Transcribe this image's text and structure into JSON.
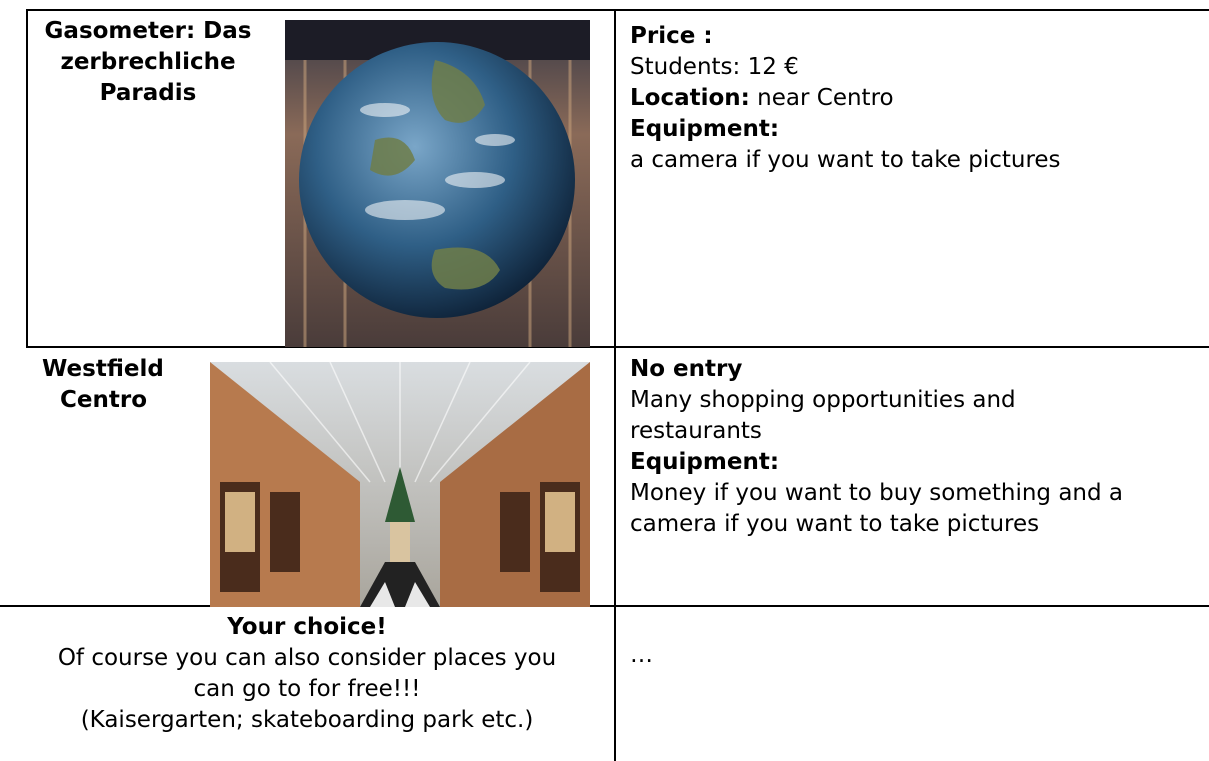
{
  "rows": [
    {
      "left_title_lines": [
        "Gasometer: Das",
        "zerbrechliche",
        "Paradis"
      ],
      "image_icon": "globe-photo",
      "right": {
        "price_label": "Price :",
        "price_value": "Students: 12 €",
        "location_label": "Location:",
        "location_value": " near Centro",
        "equipment_label": "Equipment:",
        "equipment_value": "a camera if you want to take pictures"
      }
    },
    {
      "left_title_lines": [
        "Westfield",
        "Centro"
      ],
      "image_icon": "shopping-arcade-photo",
      "right": {
        "entry_label": "No entry",
        "desc_lines": [
          "Many shopping opportunities and",
          "restaurants"
        ],
        "equipment_label": "Equipment:",
        "equipment_lines": [
          "Money if you want to buy something and a",
          "camera if you want to take pictures"
        ]
      }
    },
    {
      "left_title": "Your choice!",
      "left_lines": [
        "Of course you can also consider places you",
        "can go to for free!!!",
        "(Kaisergarten; skateboarding park etc.)"
      ],
      "right_text": "…"
    }
  ]
}
